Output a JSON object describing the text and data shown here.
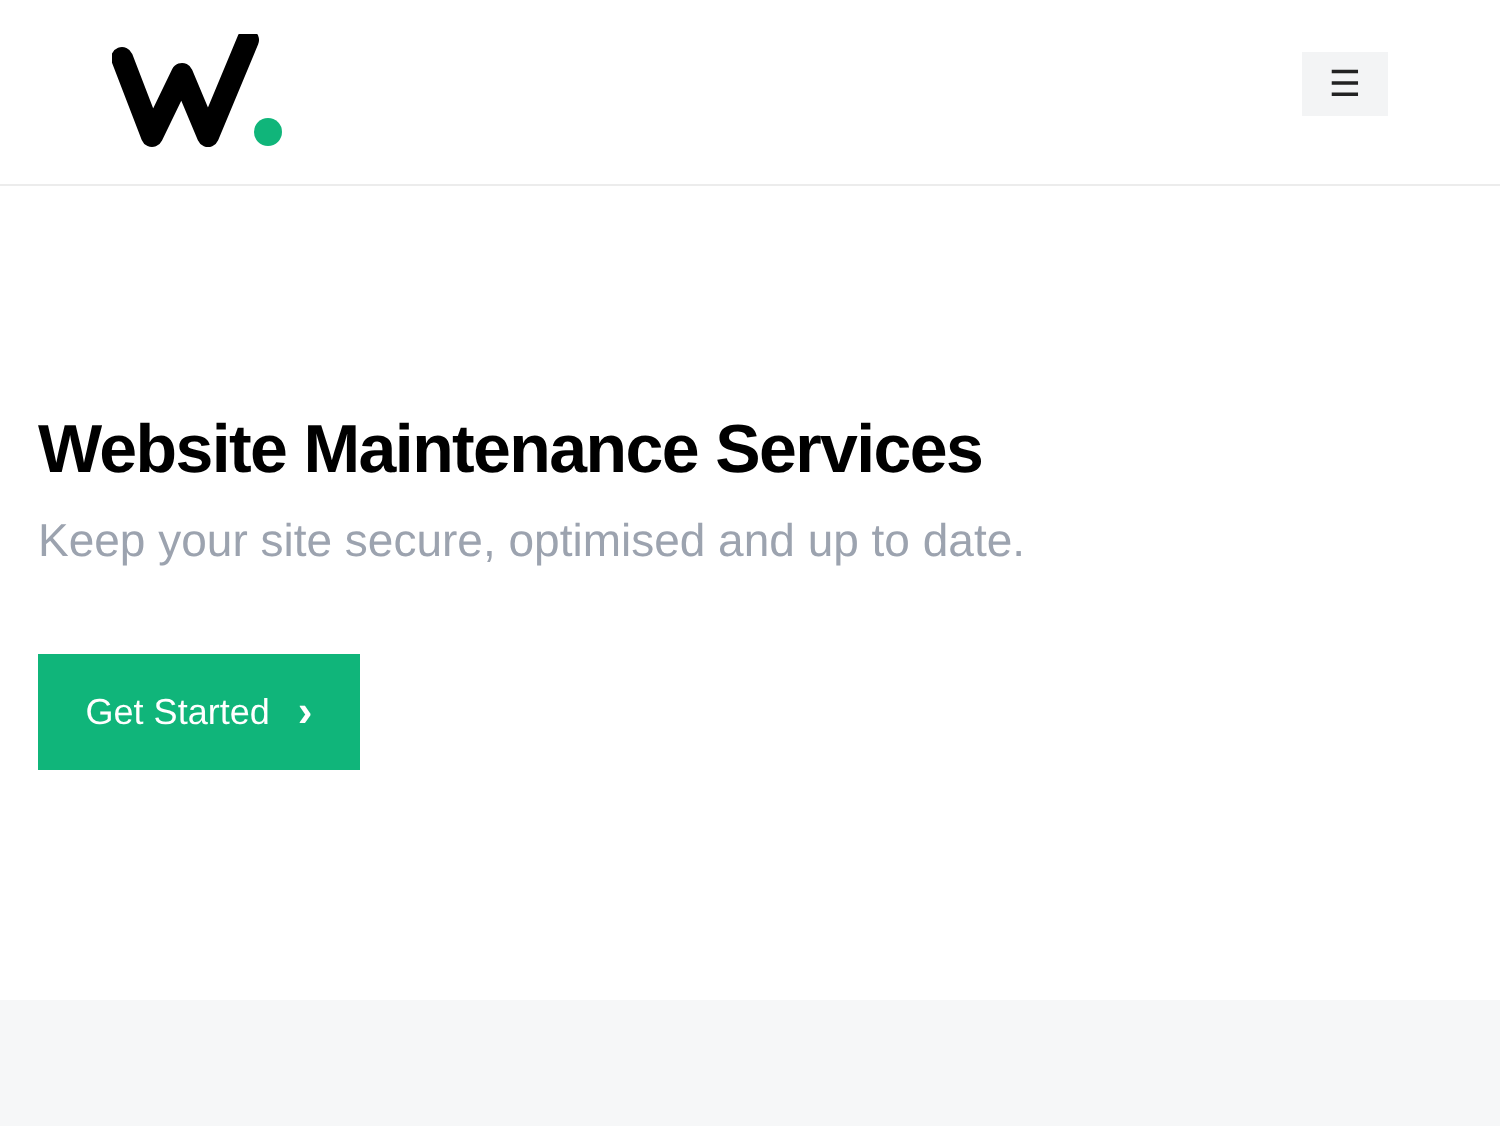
{
  "header": {
    "menu_button": "☰"
  },
  "hero": {
    "title": "Website Maintenance Services",
    "subtitle": "Keep your site secure, optimised and up to date.",
    "cta": {
      "label": "Get Started",
      "icon": "›"
    }
  }
}
